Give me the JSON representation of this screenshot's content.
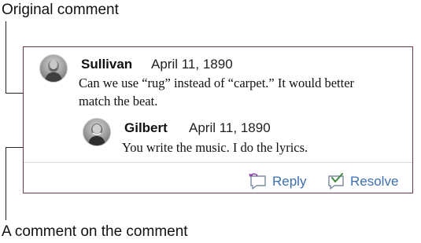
{
  "callouts": {
    "original": "Original comment",
    "reply": "A comment on the comment"
  },
  "original_comment": {
    "author": "Sullivan",
    "date": "April 11, 1890",
    "text_line1": "Can we use “rug” instead of “carpet.” It would better",
    "text_line2": "match the beat."
  },
  "reply_comment": {
    "author": "Gilbert",
    "date": "April 11, 1890",
    "text": "You write the music. I do the lyrics."
  },
  "actions": {
    "reply_label": "Reply",
    "resolve_label": "Resolve",
    "reply_icon": "comment-reply-icon",
    "resolve_icon": "comment-resolve-icon"
  },
  "colors": {
    "panel_border": "#6b3a44",
    "action_text": "#3b6fae",
    "reply_icon_accent": "#8e44ad",
    "resolve_icon_accent": "#3a8a3a"
  }
}
